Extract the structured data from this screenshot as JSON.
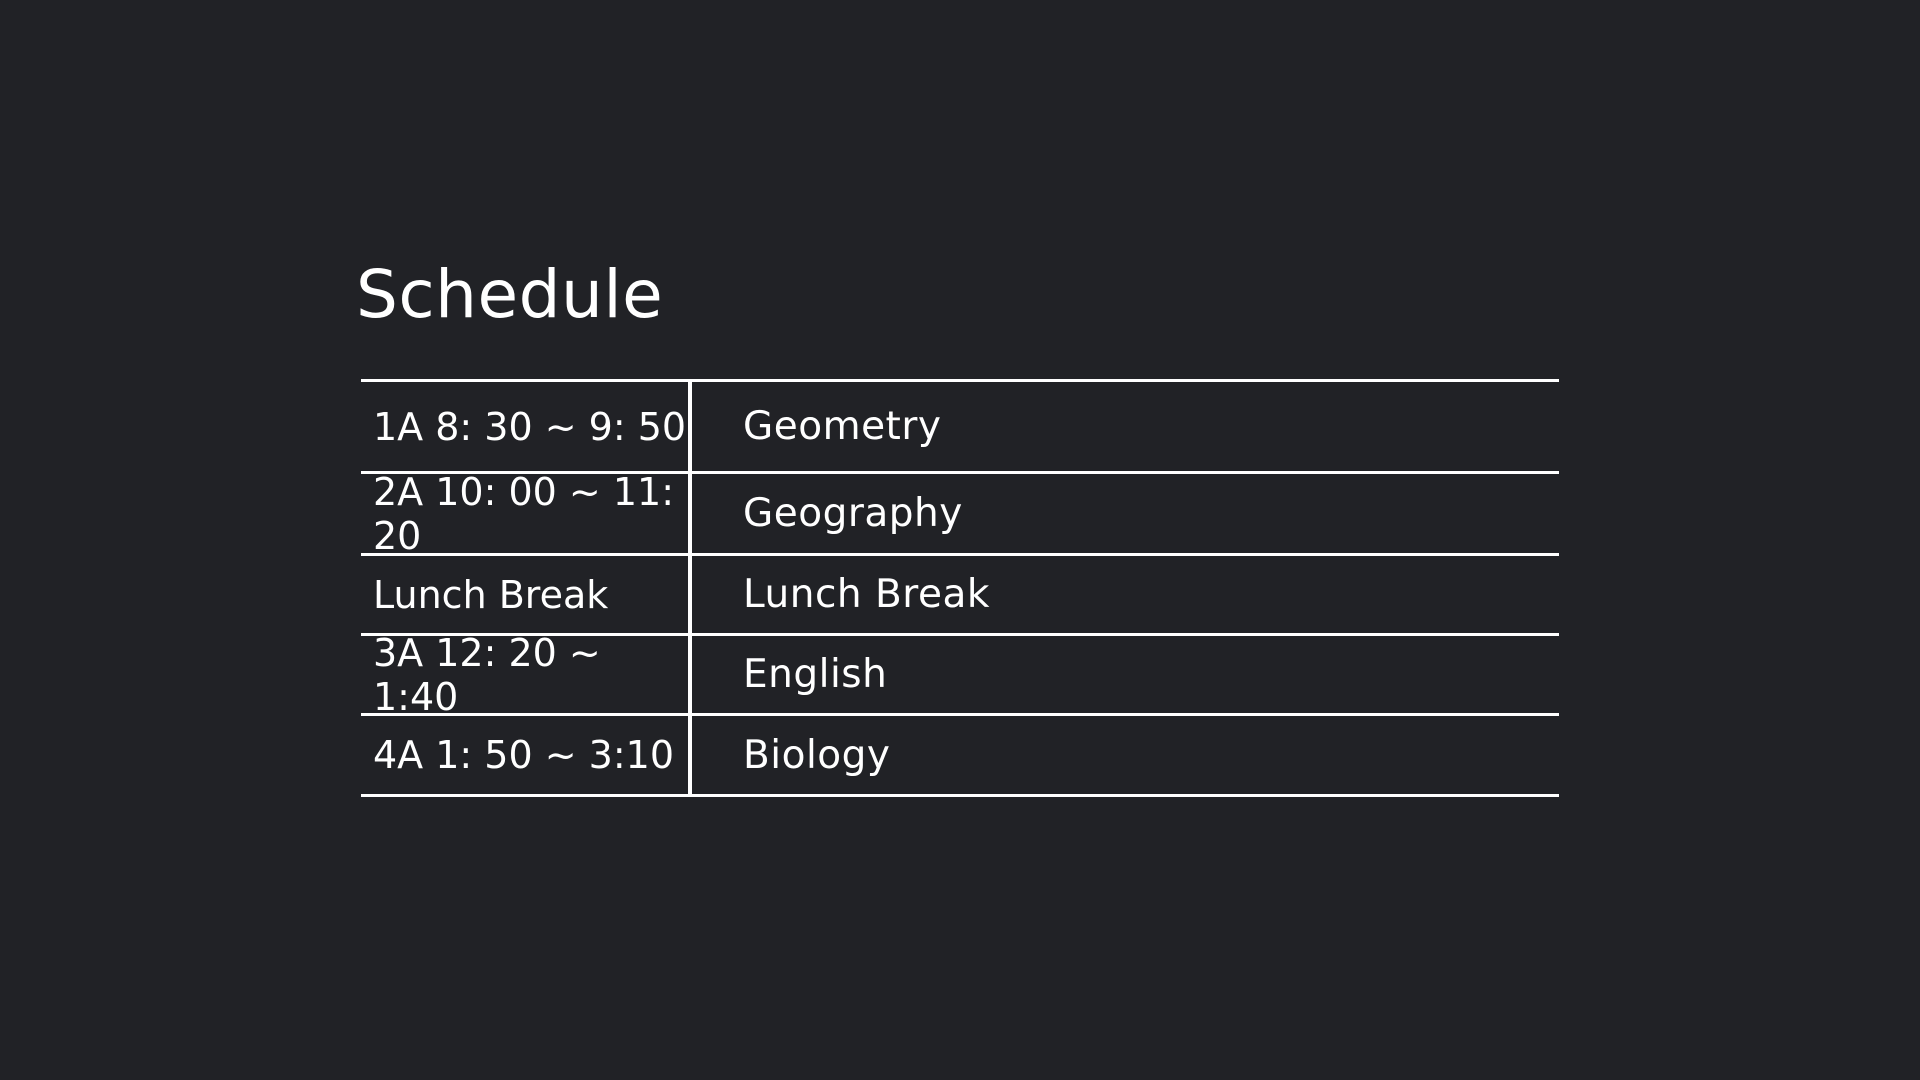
{
  "title": "Schedule",
  "rows": [
    {
      "time": "1A 8: 30 ~ 9: 50",
      "subject": "Geometry"
    },
    {
      "time": "2A 10: 00 ~ 11: 20",
      "subject": "Geography"
    },
    {
      "time": "Lunch Break",
      "subject": "Lunch Break"
    },
    {
      "time": "3A 12: 20 ~ 1:40",
      "subject": "English"
    },
    {
      "time": "4A 1: 50 ~ 3:10",
      "subject": "Biology"
    }
  ],
  "colors": {
    "background": "#212226",
    "text": "#ffffff",
    "rules": "#ffffff"
  }
}
